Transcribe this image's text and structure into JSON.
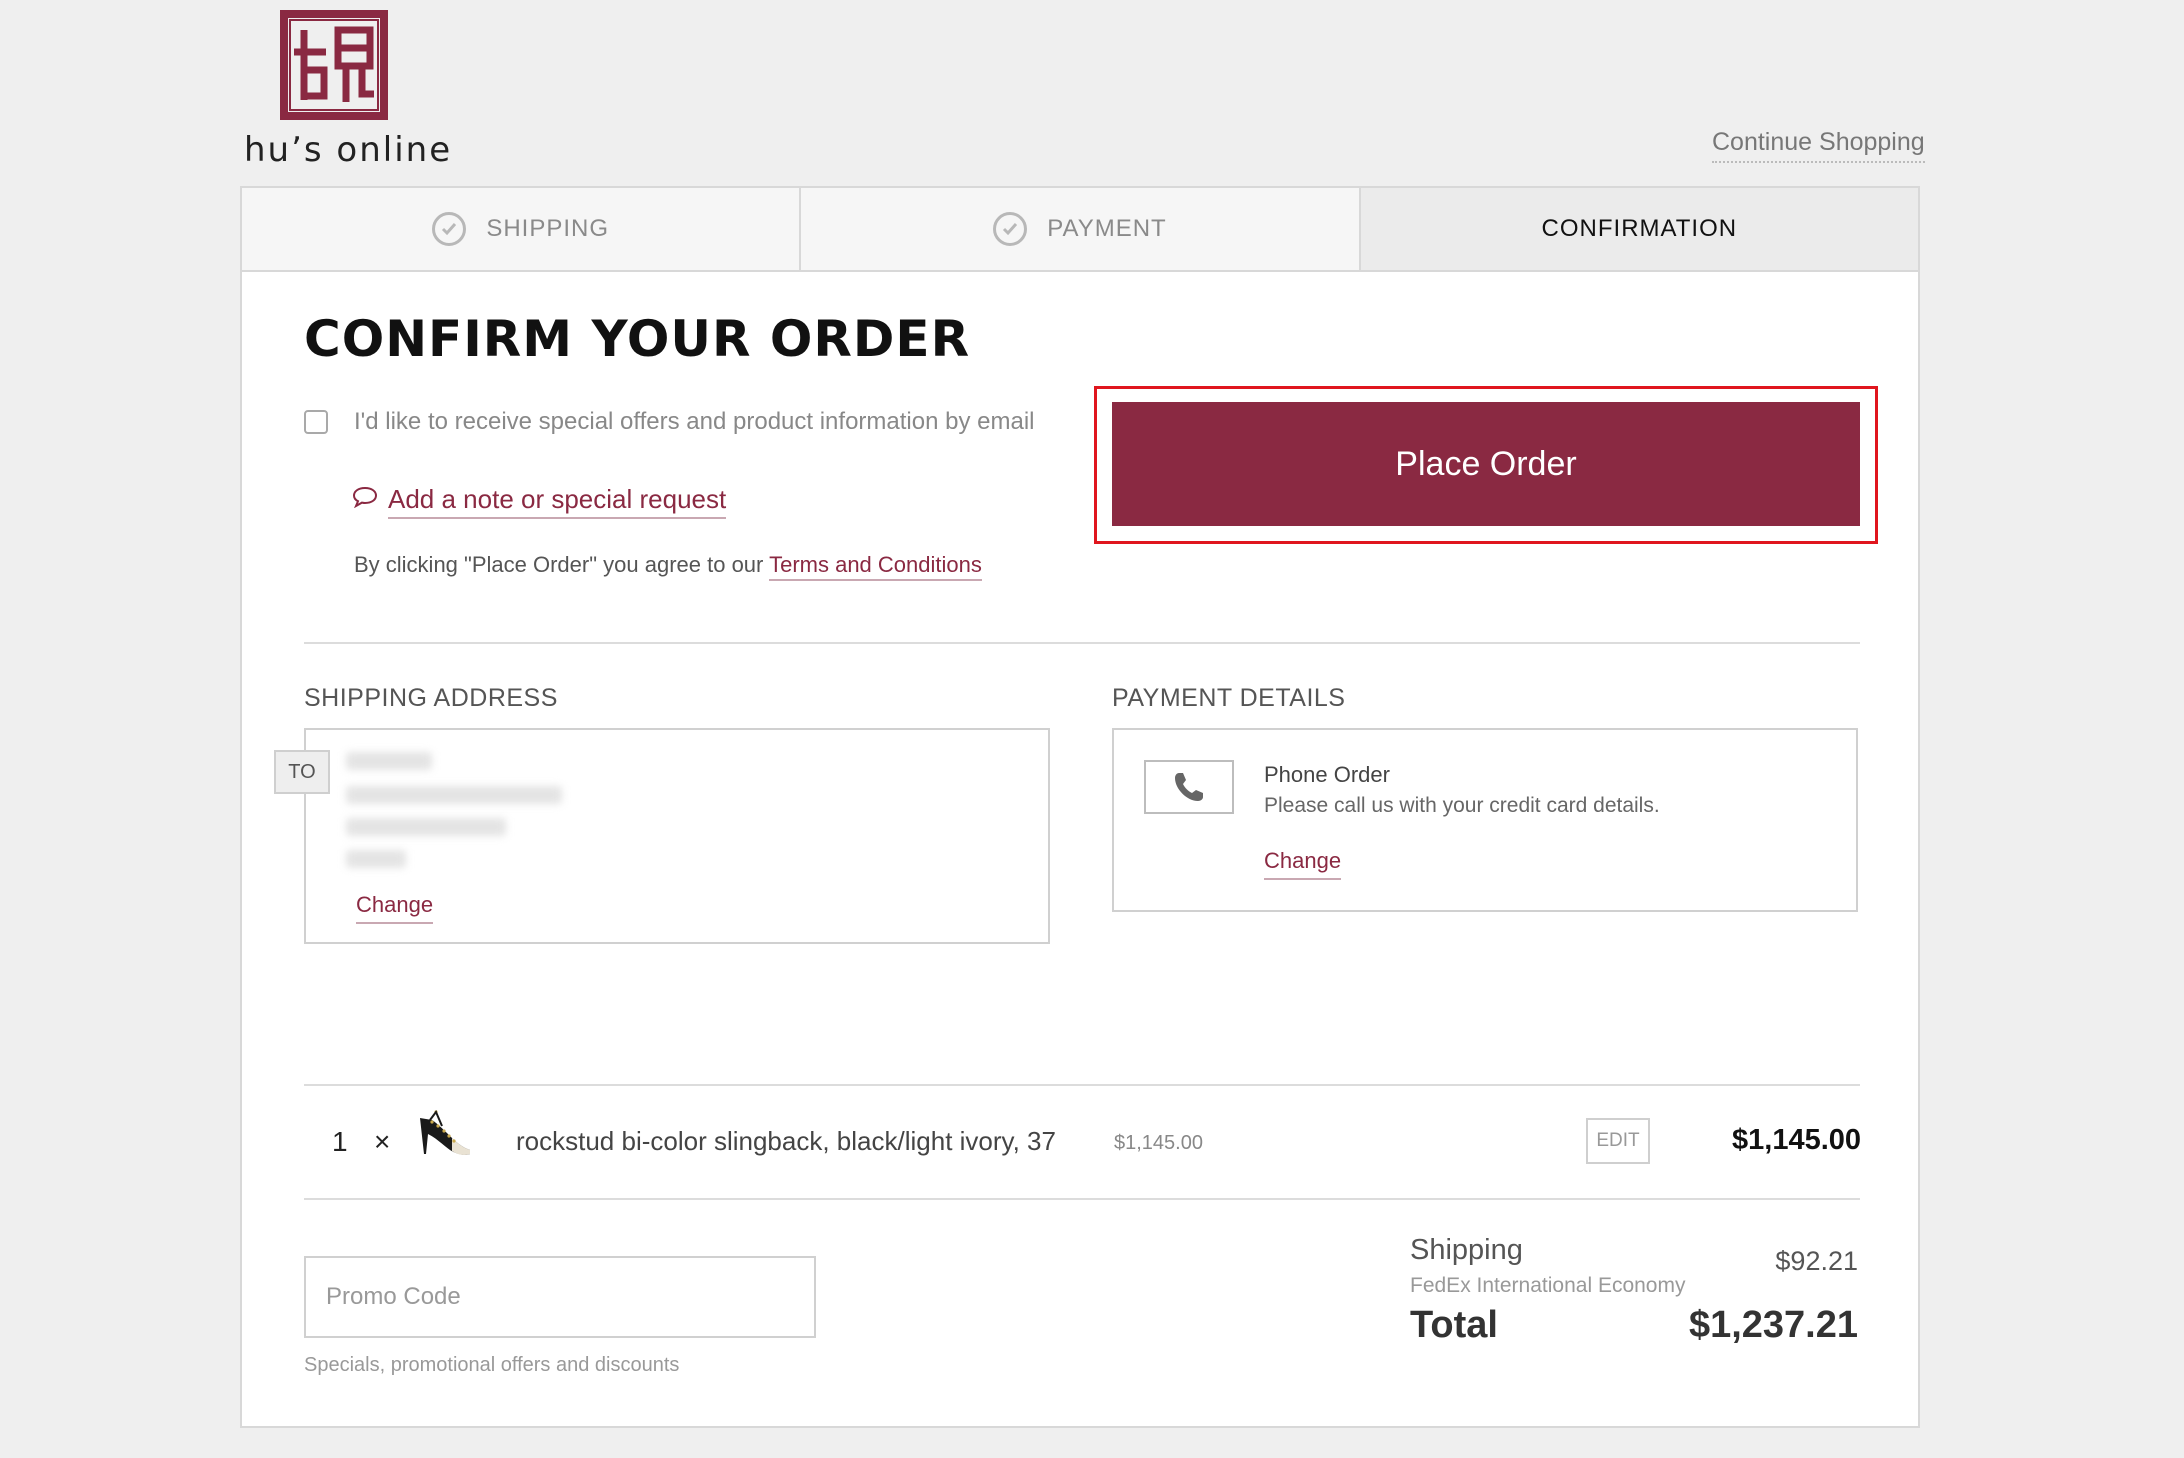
{
  "brand": {
    "name": "hu’s online",
    "color": "#8a2942"
  },
  "header": {
    "continue_shopping": "Continue Shopping"
  },
  "steps": [
    {
      "label": "SHIPPING",
      "state": "completed"
    },
    {
      "label": "PAYMENT",
      "state": "completed"
    },
    {
      "label": "CONFIRMATION",
      "state": "active"
    }
  ],
  "confirm": {
    "title": "CONFIRM YOUR ORDER",
    "optin_label": "I'd like to receive special offers and product information by email",
    "optin_checked": false,
    "note_link": "Add a note or special request",
    "agree_prefix": "By clicking \"Place Order\" you agree to our ",
    "terms_link": "Terms and Conditions",
    "place_order": "Place Order"
  },
  "shipping_address": {
    "heading": "SHIPPING ADDRESS",
    "tag": "TO",
    "change": "Change"
  },
  "payment_details": {
    "heading": "PAYMENT DETAILS",
    "method": "Phone Order",
    "description": "Please call us with your credit card details.",
    "change": "Change",
    "icon": "phone-icon"
  },
  "cart": {
    "items": [
      {
        "qty": "1",
        "times": "×",
        "name": "rockstud bi-color slingback, black/light ivory, 37",
        "unit_price": "$1,145.00",
        "edit": "EDIT",
        "total": "$1,145.00"
      }
    ]
  },
  "promo": {
    "placeholder": "Promo Code",
    "value": "",
    "help": "Specials, promotional offers and discounts"
  },
  "totals": {
    "shipping_label": "Shipping",
    "shipping_method": "FedEx International Economy",
    "shipping_price": "$92.21",
    "total_label": "Total",
    "total_price": "$1,237.21"
  },
  "colors": {
    "accent": "#8a2942",
    "highlight": "#e0161e"
  }
}
